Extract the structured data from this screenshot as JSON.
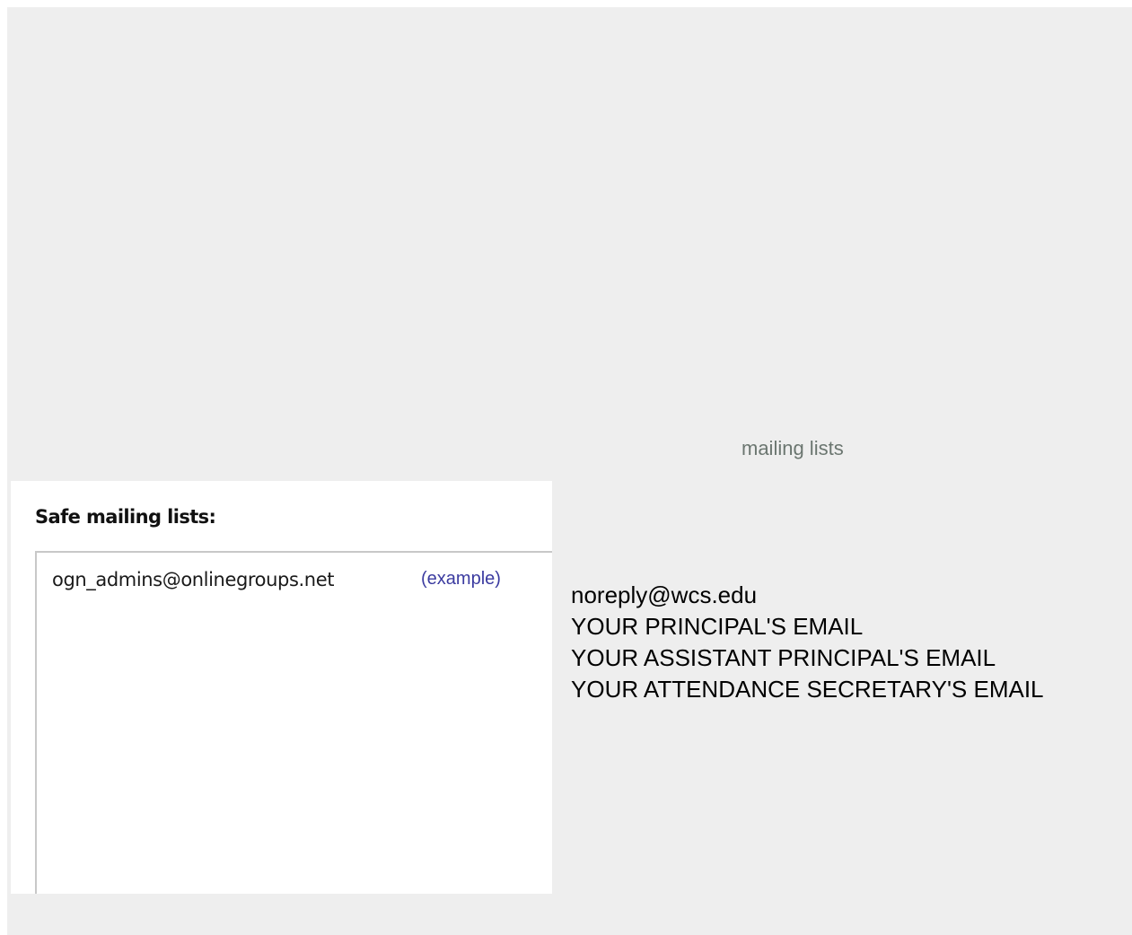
{
  "caption": "mailing lists",
  "screenshot": {
    "heading": "Safe mailing lists:",
    "entry": "ogn_admins@onlinegroups.net",
    "example_note": "(example)"
  },
  "addresses": [
    "noreply@wcs.edu",
    "YOUR PRINCIPAL'S EMAIL",
    "YOUR ASSISTANT PRINCIPAL'S EMAIL",
    "YOUR ATTENDANCE SECRETARY'S EMAIL"
  ],
  "colors": {
    "page_background": "#eeeeee",
    "caption_text": "#6b7670",
    "example_link": "#3b3ba0"
  }
}
